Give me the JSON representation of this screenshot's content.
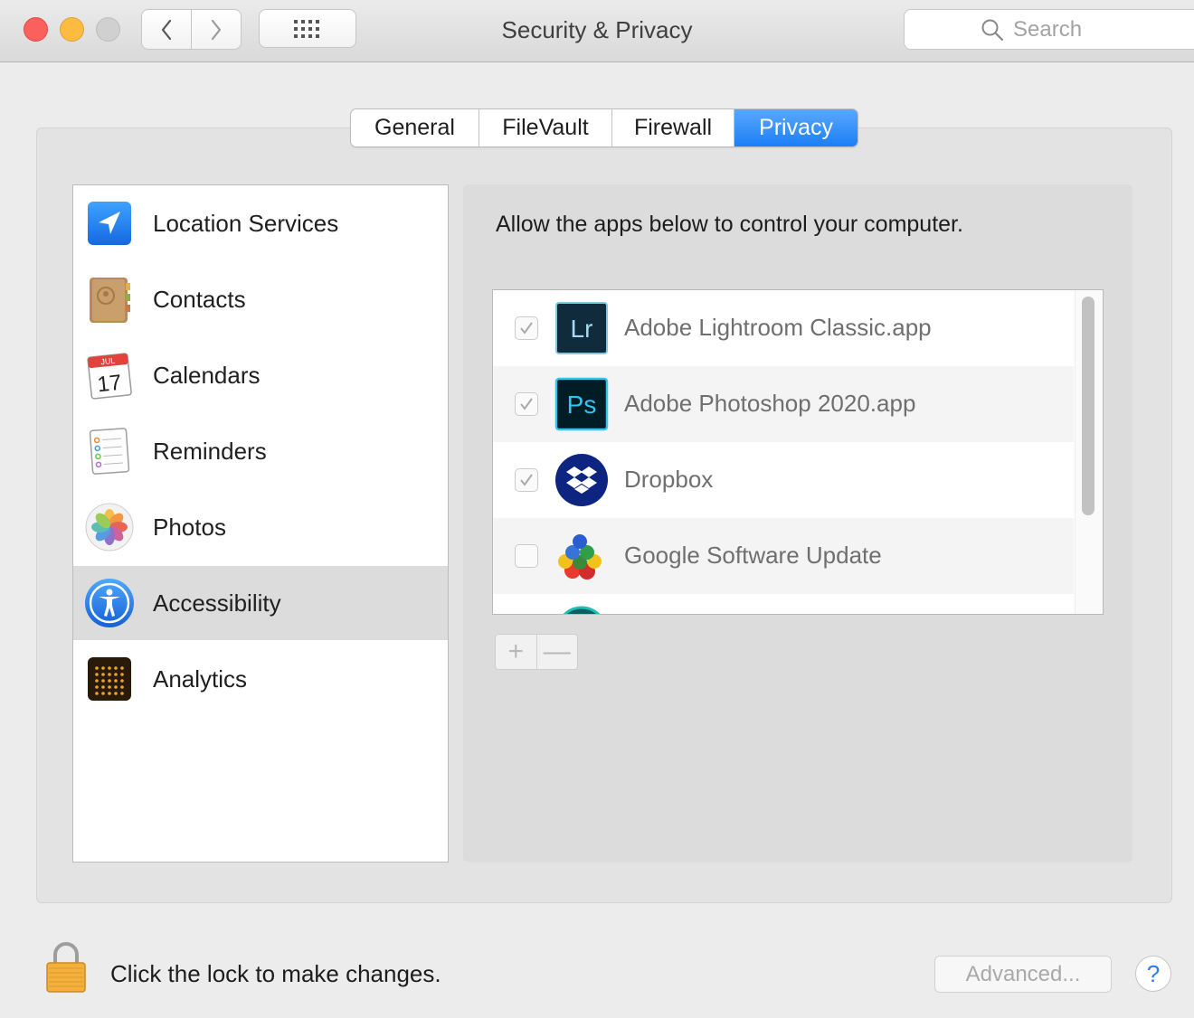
{
  "window": {
    "title": "Security & Privacy",
    "search_placeholder": "Search"
  },
  "tabs": [
    {
      "label": "General",
      "active": false
    },
    {
      "label": "FileVault",
      "active": false
    },
    {
      "label": "Firewall",
      "active": false
    },
    {
      "label": "Privacy",
      "active": true
    }
  ],
  "sidebar": {
    "items": [
      {
        "label": "Location Services",
        "icon": "location-arrow-icon"
      },
      {
        "label": "Contacts",
        "icon": "contacts-book-icon"
      },
      {
        "label": "Calendars",
        "icon": "calendar-icon",
        "month": "JUL",
        "day": "17"
      },
      {
        "label": "Reminders",
        "icon": "reminders-list-icon"
      },
      {
        "label": "Photos",
        "icon": "photos-flower-icon"
      },
      {
        "label": "Accessibility",
        "icon": "accessibility-figure-icon",
        "selected": true
      },
      {
        "label": "Analytics",
        "icon": "analytics-grid-icon"
      }
    ]
  },
  "main": {
    "instruction": "Allow the apps below to control your computer.",
    "apps": [
      {
        "name": "Adobe Lightroom Classic.app",
        "checked": true,
        "icon": "lightroom-icon",
        "icon_text": "Lr"
      },
      {
        "name": "Adobe Photoshop 2020.app",
        "checked": true,
        "icon": "photoshop-icon",
        "icon_text": "Ps"
      },
      {
        "name": "Dropbox",
        "checked": true,
        "icon": "dropbox-icon"
      },
      {
        "name": "Google Software Update",
        "checked": false,
        "icon": "google-software-update-icon"
      }
    ],
    "add_label": "+",
    "remove_label": "—"
  },
  "footer": {
    "lock_text": "Click the lock to make changes.",
    "advanced_label": "Advanced...",
    "help_label": "?"
  },
  "colors": {
    "accent": "#1b7ff5",
    "selected_row": "#dcdcdc"
  }
}
